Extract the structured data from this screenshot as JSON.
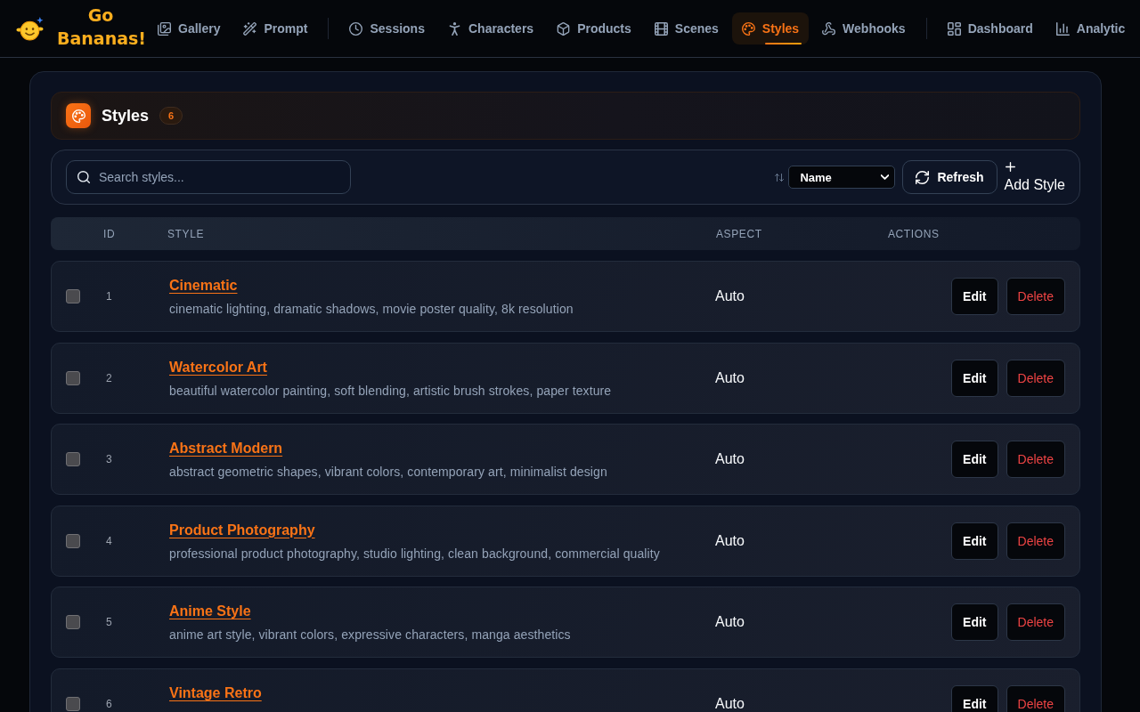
{
  "brand": {
    "name": "Go Bananas!"
  },
  "nav": {
    "groups": [
      {
        "items": [
          {
            "label": "Gallery",
            "selected": false
          },
          {
            "label": "Prompt",
            "selected": false
          }
        ]
      },
      {
        "items": [
          {
            "label": "Sessions",
            "selected": false
          },
          {
            "label": "Characters",
            "selected": false
          },
          {
            "label": "Products",
            "selected": false
          },
          {
            "label": "Scenes",
            "selected": false
          },
          {
            "label": "Styles",
            "selected": true
          },
          {
            "label": "Webhooks",
            "selected": false
          }
        ]
      },
      {
        "items": [
          {
            "label": "Dashboard",
            "selected": false
          },
          {
            "label": "Analytic",
            "selected": false
          }
        ]
      }
    ]
  },
  "page_header": {
    "title": "Styles",
    "count": "6"
  },
  "toolbar": {
    "search": {
      "placeholder": "Search styles..."
    },
    "sort": {
      "value": "Name"
    },
    "refresh_button": "Refresh",
    "add_button": "Add Style"
  },
  "table": {
    "columns": [
      "ID",
      "STYLE",
      "ASPECT",
      "ACTIONS"
    ],
    "rows": [
      {
        "checked": false,
        "id": "1",
        "name": "Cinematic",
        "description": "cinematic lighting, dramatic shadows, movie poster quality, 8k resolution",
        "aspect": "Auto",
        "edit": "Edit",
        "delete": "Delete"
      },
      {
        "checked": false,
        "id": "2",
        "name": "Watercolor Art",
        "description": "beautiful watercolor painting, soft blending, artistic brush strokes, paper texture",
        "aspect": "Auto",
        "edit": "Edit",
        "delete": "Delete"
      },
      {
        "checked": false,
        "id": "3",
        "name": "Abstract Modern",
        "description": "abstract geometric shapes, vibrant colors, contemporary art, minimalist design",
        "aspect": "Auto",
        "edit": "Edit",
        "delete": "Delete"
      },
      {
        "checked": false,
        "id": "4",
        "name": "Product Photography",
        "description": "professional product photography, studio lighting, clean background, commercial quality",
        "aspect": "Auto",
        "edit": "Edit",
        "delete": "Delete"
      },
      {
        "checked": false,
        "id": "5",
        "name": "Anime Style",
        "description": "anime art style, vibrant colors, expressive characters, manga aesthetics",
        "aspect": "Auto",
        "edit": "Edit",
        "delete": "Delete"
      },
      {
        "checked": false,
        "id": "6",
        "name": "Vintage Retro",
        "aspect": "Auto",
        "edit": "Edit",
        "delete": "Delete"
      }
    ]
  }
}
